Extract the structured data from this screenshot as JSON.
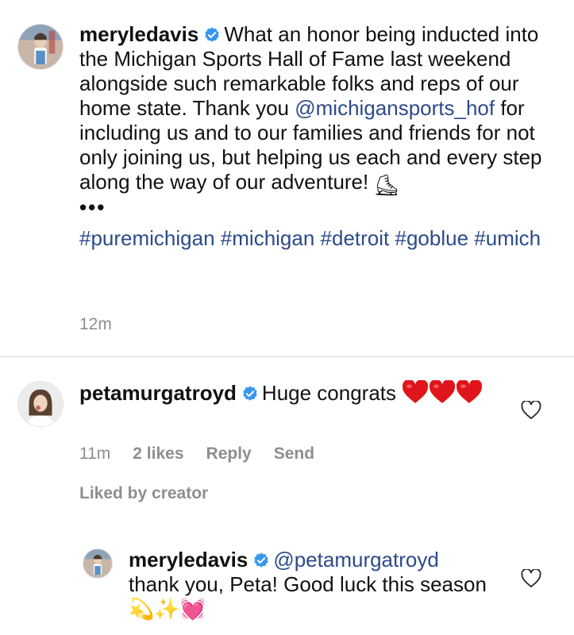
{
  "caption": {
    "username": "meryledavis",
    "text_before_mention": "What an honor being inducted into the Michigan Sports Hall of Fame last weekend alongside such remarkable folks and reps of our home state. Thank you ",
    "mention": "@michigansports_hof",
    "text_after_mention": " for including us and to our families and friends for not only joining us, but helping us each and every step along the way of our adventure!",
    "emoji": "⛸",
    "more": "•••",
    "hashtags": [
      "#puremichigan",
      "#michigan",
      "#detroit",
      "#goblue",
      "#umich"
    ],
    "time": "12m"
  },
  "comment": {
    "username": "petamurgatroyd",
    "text": "Huge congrats",
    "emoji_hearts": 3,
    "time": "11m",
    "likes": "2 likes",
    "reply_label": "Reply",
    "send_label": "Send",
    "liked_by": "Liked by creator"
  },
  "reply": {
    "username": "meryledavis",
    "mention": "@petamurgatroyd",
    "text": "thank you, Peta! Good luck this season",
    "emojis": "💫✨💓"
  },
  "colors": {
    "verified": "#3897f0",
    "link": "#2c4a8a",
    "muted": "#8e8e8e",
    "heart": "#e0151b",
    "divider": "#dbdbdb"
  },
  "icons": {
    "verified": "verified-badge-icon",
    "like": "heart-outline-icon",
    "emoji_heart": "red-heart-icon"
  }
}
